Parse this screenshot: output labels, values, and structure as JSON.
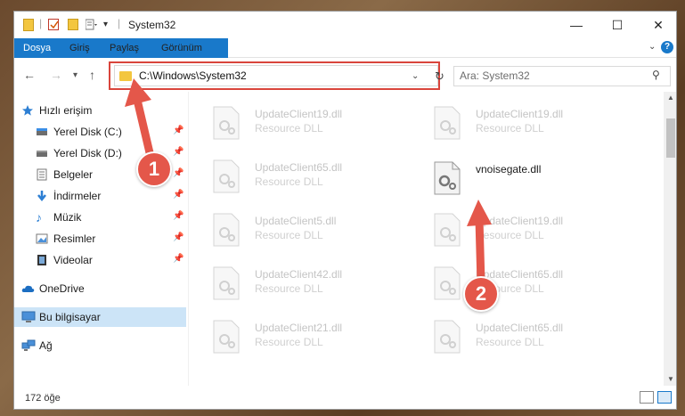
{
  "window": {
    "title": "System32",
    "minimize_glyph": "—",
    "maximize_glyph": "☐",
    "close_glyph": "✕"
  },
  "ribbon": {
    "tabs": [
      {
        "label": "Dosya"
      },
      {
        "label": "Giriş"
      },
      {
        "label": "Paylaş"
      },
      {
        "label": "Görünüm"
      }
    ]
  },
  "address": {
    "path": "C:\\Windows\\System32",
    "search_placeholder": "Ara: System32"
  },
  "nav": {
    "items": [
      {
        "label": "Hızlı erişim",
        "icon": "star-icon"
      },
      {
        "label": "Yerel Disk (C:)",
        "icon": "drive-icon",
        "pinned": true
      },
      {
        "label": "Yerel Disk (D:)",
        "icon": "drive-icon",
        "pinned": true
      },
      {
        "label": "Belgeler",
        "icon": "documents-icon",
        "pinned": true
      },
      {
        "label": "İndirmeler",
        "icon": "download-icon",
        "pinned": true
      },
      {
        "label": "Müzik",
        "icon": "music-icon",
        "pinned": true
      },
      {
        "label": "Resimler",
        "icon": "pictures-icon",
        "pinned": true
      },
      {
        "label": "Videolar",
        "icon": "videos-icon",
        "pinned": true
      },
      {
        "label": "OneDrive",
        "icon": "cloud-icon"
      },
      {
        "label": "Bu bilgisayar",
        "icon": "computer-icon",
        "selected": true
      },
      {
        "label": "Ağ",
        "icon": "network-icon"
      }
    ]
  },
  "files": [
    {
      "name": "UpdateClient19.dll",
      "type": "Resource DLL"
    },
    {
      "name": "UpdateClient19.dll",
      "type": "Resource DLL"
    },
    {
      "name": "UpdateClient65.dll",
      "type": "Resource DLL"
    },
    {
      "name": "vnoisegate.dll",
      "type": ""
    },
    {
      "name": "UpdateClient5.dll",
      "type": "Resource DLL"
    },
    {
      "name": "UpdateClient19.dll",
      "type": "Resource DLL"
    },
    {
      "name": "UpdateClient42.dll",
      "type": "Resource DLL"
    },
    {
      "name": "UpdateClient65.dll",
      "type": "Resource DLL"
    },
    {
      "name": "UpdateClient21.dll",
      "type": "Resource DLL"
    },
    {
      "name": "UpdateClient65.dll",
      "type": "Resource DLL"
    }
  ],
  "status": {
    "count_text": "172 öğe"
  },
  "annotations": [
    {
      "number": "1"
    },
    {
      "number": "2"
    }
  ],
  "colors": {
    "accent": "#1979ca",
    "highlight": "#d9453c",
    "selection": "#cce4f7"
  }
}
